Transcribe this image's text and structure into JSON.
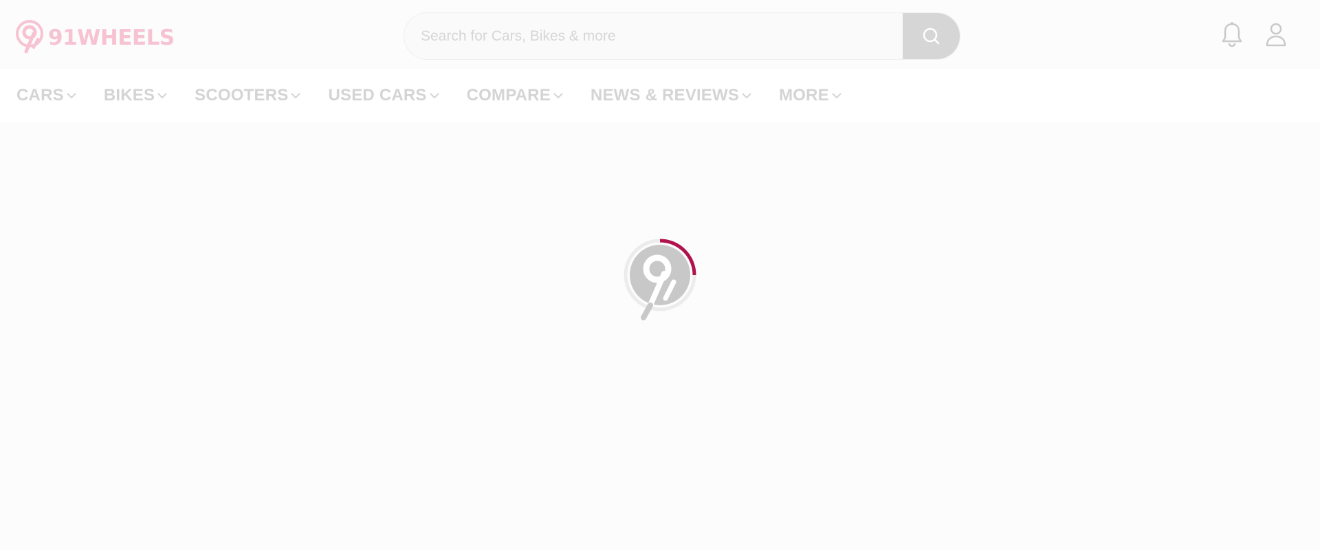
{
  "brand": {
    "name": "91WHEELS",
    "color": "#f7c3d3"
  },
  "search": {
    "placeholder": "Search for Cars, Bikes & more",
    "value": "",
    "icon": "search-icon"
  },
  "header_icons": [
    {
      "name": "bell-icon"
    },
    {
      "name": "user-icon"
    }
  ],
  "nav": {
    "items": [
      {
        "label": "CARS"
      },
      {
        "label": "BIKES"
      },
      {
        "label": "SCOOTERS"
      },
      {
        "label": "USED CARS"
      },
      {
        "label": "COMPARE"
      },
      {
        "label": "NEWS & REVIEWS"
      },
      {
        "label": "MORE"
      }
    ]
  },
  "loader": {
    "icon": "loading-spinner-icon",
    "accent": "#b0124e"
  },
  "colors": {
    "nav_text": "#d4d4d4",
    "background": "#fcfcfc",
    "search_button": "#d6d6d6"
  }
}
